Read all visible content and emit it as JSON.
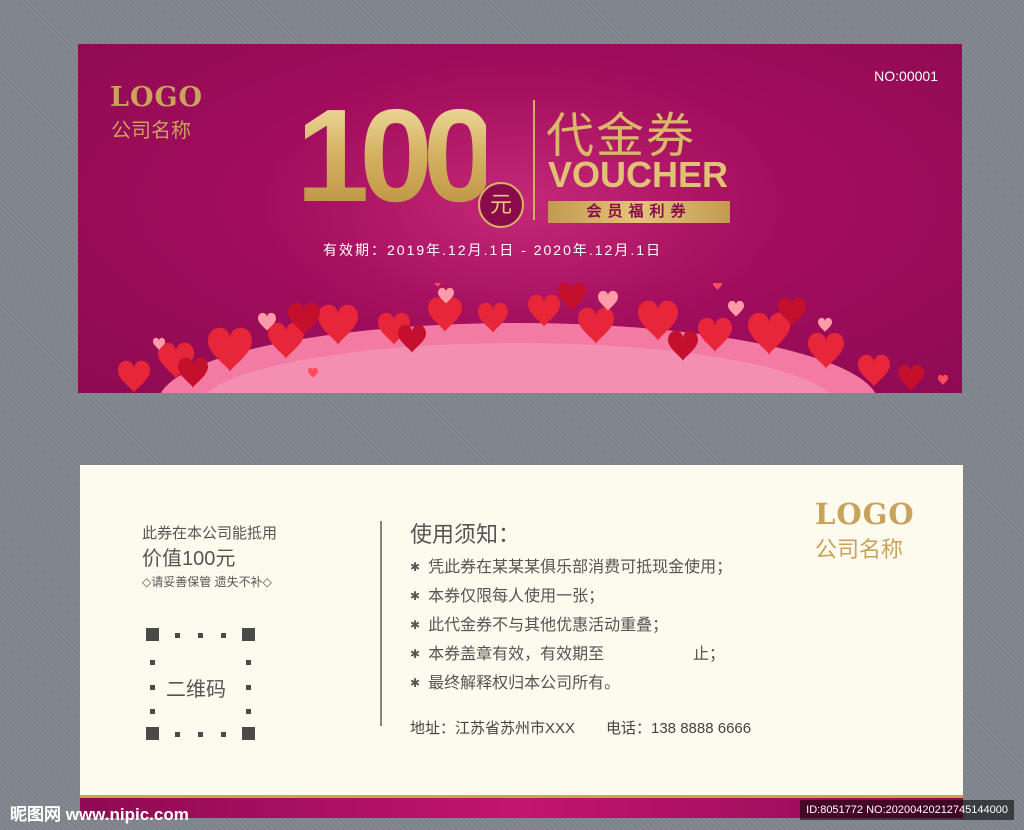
{
  "front": {
    "logo": "LOGO",
    "company": "公司名称",
    "serial": "NO:00001",
    "amount": "100",
    "unit": "元",
    "title_cn": "代金券",
    "title_en": "VOUCHER",
    "member": "会员福利券",
    "validity": "有效期：2019年.12月.1日 - 2020年.12月.1日"
  },
  "back": {
    "line1": "此券在本公司能抵用",
    "line2": "价值100元",
    "line3": "◇请妥善保管 遗失不补◇",
    "qr_label": "二维码",
    "notes_title": "使用须知：",
    "notes": [
      "凭此券在某某某俱乐部消费可抵现金使用；",
      "本券仅限每人使用一张；",
      "此代金券不与其他优惠活动重叠；",
      "本券盖章有效，有效期至                    止；",
      "最终解释权归本公司所有。"
    ],
    "address": "地址：江苏省苏州市XXX",
    "phone": "电话：138 8888 6666",
    "logo": "LOGO",
    "company": "公司名称"
  },
  "watermark": "昵图网 www.nipic.com",
  "id_badge": "ID:8051772 NO:20200420212745144000",
  "colors": {
    "magenta": "#a00d5c",
    "gold": "#c9a25c",
    "cream": "#fdfbed"
  }
}
